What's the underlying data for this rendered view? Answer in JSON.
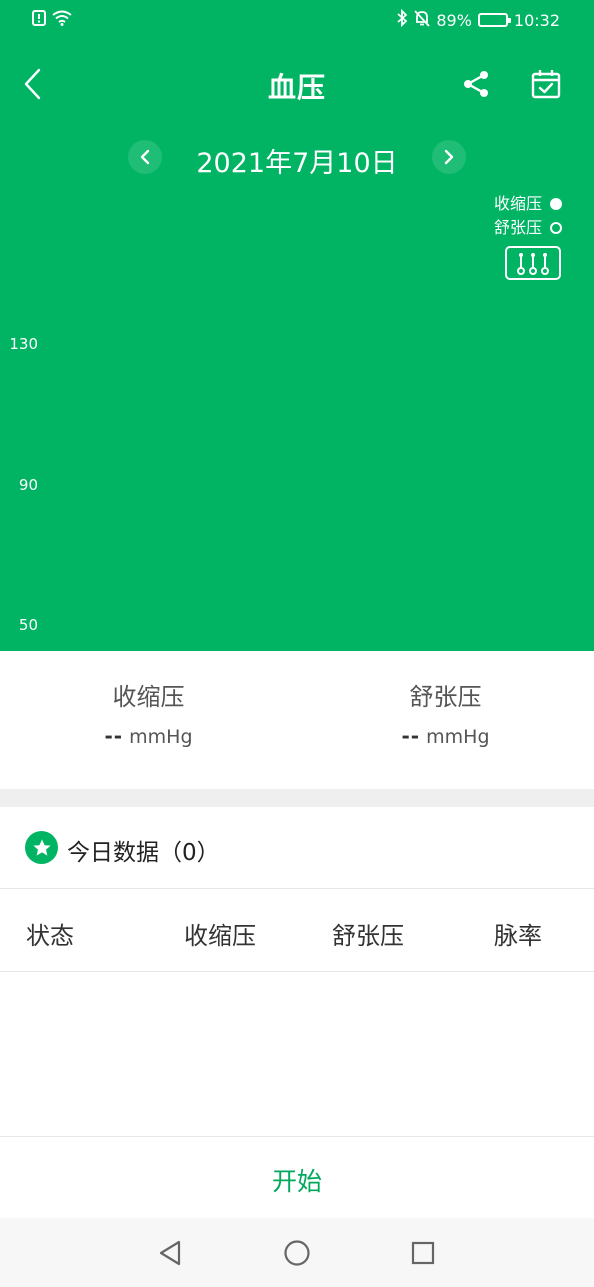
{
  "status_bar": {
    "battery_percent": "89%",
    "battery_level": 0.89,
    "time": "10:32",
    "icons": [
      "sim-alert-icon",
      "wifi-icon",
      "bluetooth-icon",
      "bell-off-icon",
      "battery-icon"
    ]
  },
  "header": {
    "title": "血压",
    "icons": [
      "back-icon",
      "share-icon",
      "calendar-check-icon"
    ]
  },
  "date_nav": {
    "date": "2021年7月10日",
    "icons": [
      "chevron-left-icon",
      "chevron-right-icon"
    ]
  },
  "legend": {
    "systolic": "收缩压",
    "diastolic": "舒张压",
    "toggle_icon": "sliders-icon"
  },
  "chart_data": {
    "type": "scatter",
    "series": [
      {
        "name": "收缩压",
        "values": []
      },
      {
        "name": "舒张压",
        "values": []
      }
    ],
    "y_ticks": [
      "130",
      "90",
      "50"
    ]
  },
  "summary": {
    "systolic_label": "收缩压",
    "systolic_value": "--",
    "systolic_unit": "mmHg",
    "diastolic_label": "舒张压",
    "diastolic_value": "--",
    "diastolic_unit": "mmHg"
  },
  "today": {
    "title": "今日数据（0）",
    "icon": "star-icon"
  },
  "table": {
    "columns": [
      "状态",
      "收缩压",
      "舒张压",
      "脉率"
    ],
    "rows": []
  },
  "start_button": "开始",
  "nav_bar": {
    "icons": [
      "nav-back-icon",
      "nav-home-icon",
      "nav-recents-icon"
    ]
  },
  "colors": {
    "primary": "#00b464",
    "start_text": "#00a85c"
  }
}
